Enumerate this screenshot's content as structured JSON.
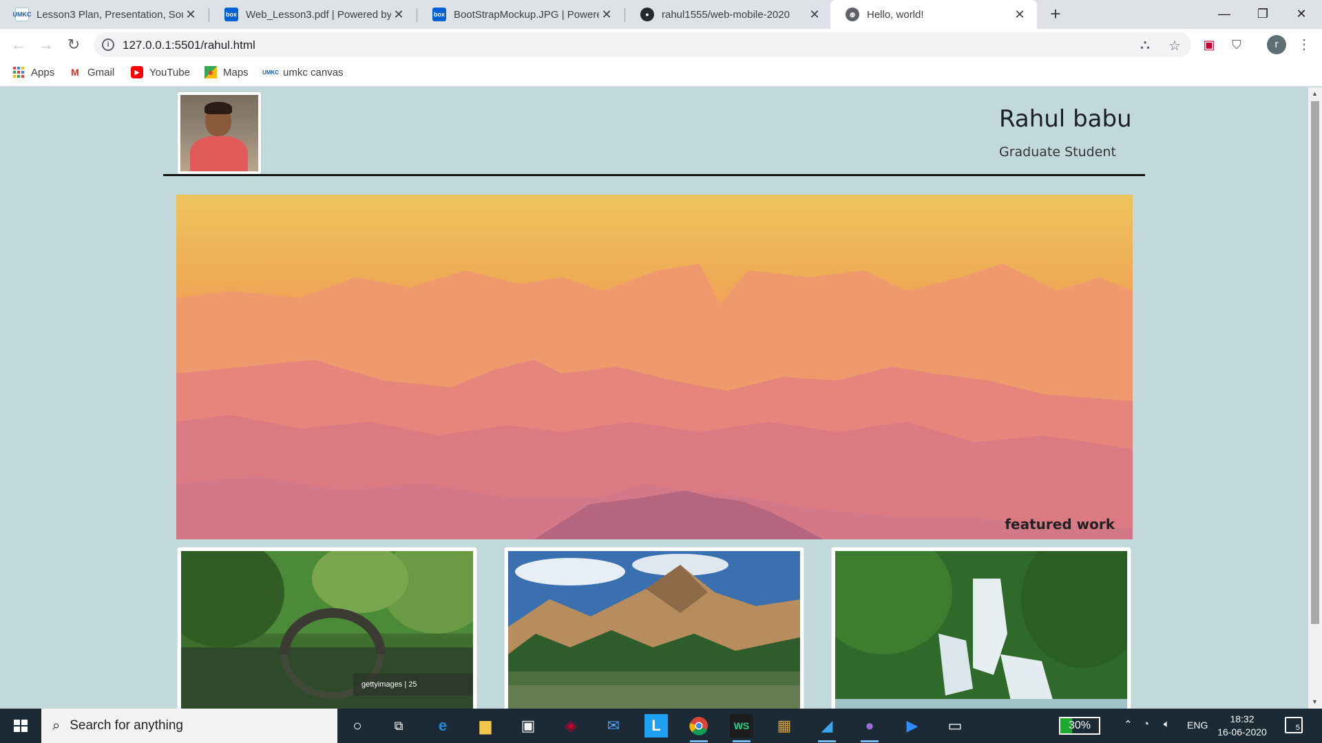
{
  "browser": {
    "tabs": [
      {
        "title": "Lesson3 Plan, Presentation, Sourc",
        "icon": "umkc-icon"
      },
      {
        "title": "Web_Lesson3.pdf | Powered by B",
        "icon": "box-icon"
      },
      {
        "title": "BootStrapMockup.JPG | Powered",
        "icon": "box-icon"
      },
      {
        "title": "rahul1555/web-mobile-2020",
        "icon": "github-icon"
      },
      {
        "title": "Hello, world!",
        "icon": "globe-icon"
      }
    ],
    "url": "127.0.0.1:5501/rahul.html",
    "profile_initial": "r",
    "bookmarks": [
      {
        "label": "Apps",
        "icon": "apps-grid-icon"
      },
      {
        "label": "Gmail",
        "icon": "gmail-icon"
      },
      {
        "label": "YouTube",
        "icon": "youtube-icon"
      },
      {
        "label": "Maps",
        "icon": "maps-icon"
      },
      {
        "label": "umkc canvas",
        "icon": "umkc-icon"
      }
    ]
  },
  "page": {
    "name": "Rahul babu",
    "role": "Graduate Student",
    "hero_caption": "featured work",
    "gallery": [
      {
        "alt": "stone arch bridge over green lake",
        "watermark": "gettyimages | 25"
      },
      {
        "alt": "mountain lake with pine forest"
      },
      {
        "alt": "tropical waterfall in jungle"
      }
    ]
  },
  "taskbar": {
    "search_placeholder": "Search for anything",
    "battery": "30%",
    "language": "ENG",
    "time": "18:32",
    "date": "16-06-2020",
    "notifications": "5"
  },
  "colors": {
    "page_background": "#c2d9dc",
    "taskbar": "#1b2a34"
  }
}
